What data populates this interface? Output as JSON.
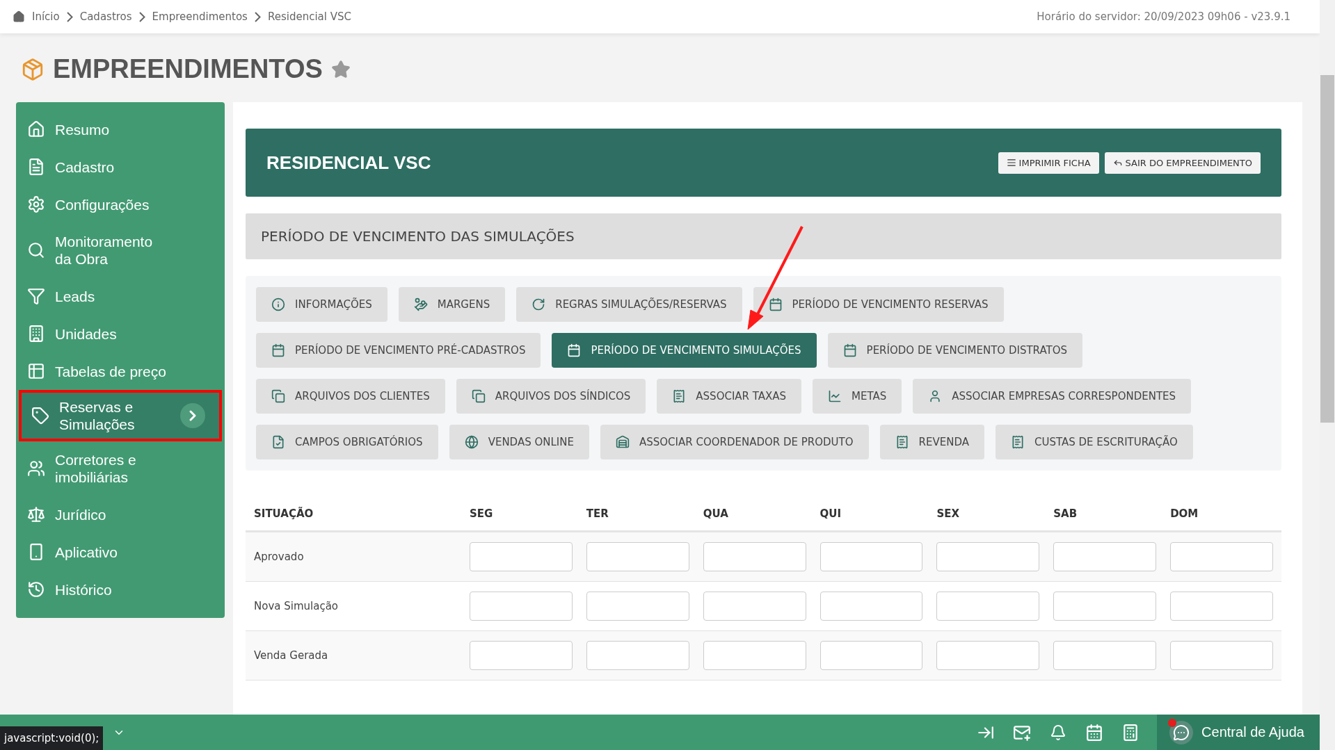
{
  "breadcrumbs": [
    {
      "label": "Início"
    },
    {
      "label": "Cadastros"
    },
    {
      "label": "Empreendimentos"
    },
    {
      "label": "Residencial VSC"
    }
  ],
  "server_time": "Horário do servidor: 20/09/2023 09h06 - v23.9.1",
  "page_title": "EMPREENDIMENTOS",
  "favorite": false,
  "sidebar": {
    "items": [
      {
        "label": "Resumo",
        "selected": false,
        "annotated": false
      },
      {
        "label": "Cadastro",
        "selected": false,
        "annotated": false
      },
      {
        "label": "Configurações",
        "selected": false,
        "annotated": false
      },
      {
        "label": "Monitoramento da Obra",
        "selected": false,
        "annotated": false
      },
      {
        "label": "Leads",
        "selected": false,
        "annotated": false
      },
      {
        "label": "Unidades",
        "selected": false,
        "annotated": false
      },
      {
        "label": "Tabelas de preço",
        "selected": false,
        "annotated": false
      },
      {
        "label": "Reservas e Simulações",
        "selected": true,
        "annotated": true
      },
      {
        "label": "Corretores e imobiliárias",
        "selected": false,
        "annotated": false
      },
      {
        "label": "Jurídico",
        "selected": false,
        "annotated": false
      },
      {
        "label": "Aplicativo",
        "selected": false,
        "annotated": false
      },
      {
        "label": "Histórico",
        "selected": false,
        "annotated": false
      }
    ]
  },
  "header": {
    "title": "RESIDENCIAL VSC",
    "buttons": [
      {
        "label": "IMPRIMIR FICHA"
      },
      {
        "label": "SAIR DO EMPREENDIMENTO"
      }
    ]
  },
  "section_title": "PERÍODO DE VENCIMENTO DAS SIMULAÇÕES",
  "tabs": [
    {
      "label": "INFORMAÇÕES",
      "selected": false,
      "pointed": false
    },
    {
      "label": "MARGENS",
      "selected": false,
      "pointed": false
    },
    {
      "label": "REGRAS SIMULAÇÕES/RESERVAS",
      "selected": false,
      "pointed": false
    },
    {
      "label": "PERÍODO DE VENCIMENTO RESERVAS",
      "selected": false,
      "pointed": false
    },
    {
      "label": "PERÍODO DE VENCIMENTO PRÉ-CADASTROS",
      "selected": false,
      "pointed": false
    },
    {
      "label": "PERÍODO DE VENCIMENTO SIMULAÇÕES",
      "selected": true,
      "pointed": true
    },
    {
      "label": "PERÍODO DE VENCIMENTO DISTRATOS",
      "selected": false,
      "pointed": false
    },
    {
      "label": "ARQUIVOS DOS CLIENTES",
      "selected": false,
      "pointed": false
    },
    {
      "label": "ARQUIVOS DOS SÍNDICOS",
      "selected": false,
      "pointed": false
    },
    {
      "label": "ASSOCIAR TAXAS",
      "selected": false,
      "pointed": false
    },
    {
      "label": "METAS",
      "selected": false,
      "pointed": false
    },
    {
      "label": "ASSOCIAR EMPRESAS CORRESPONDENTES",
      "selected": false,
      "pointed": false
    },
    {
      "label": "CAMPOS OBRIGATÓRIOS",
      "selected": false,
      "pointed": false
    },
    {
      "label": "VENDAS ONLINE",
      "selected": false,
      "pointed": false
    },
    {
      "label": "ASSOCIAR COORDENADOR DE PRODUTO",
      "selected": false,
      "pointed": false
    },
    {
      "label": "REVENDA",
      "selected": false,
      "pointed": false
    },
    {
      "label": "CUSTAS DE ESCRITURAÇÃO",
      "selected": false,
      "pointed": false
    }
  ],
  "table": {
    "columns": [
      "SITUAÇÃO",
      "SEG",
      "TER",
      "QUA",
      "QUI",
      "SEX",
      "SAB",
      "DOM"
    ],
    "rows": [
      {
        "label": "Aprovado"
      },
      {
        "label": "Nova Simulação"
      },
      {
        "label": "Venda Gerada"
      }
    ]
  },
  "status_url": "javascript:void(0);",
  "help_button": {
    "label": "Central de Ajuda",
    "notification": true
  }
}
